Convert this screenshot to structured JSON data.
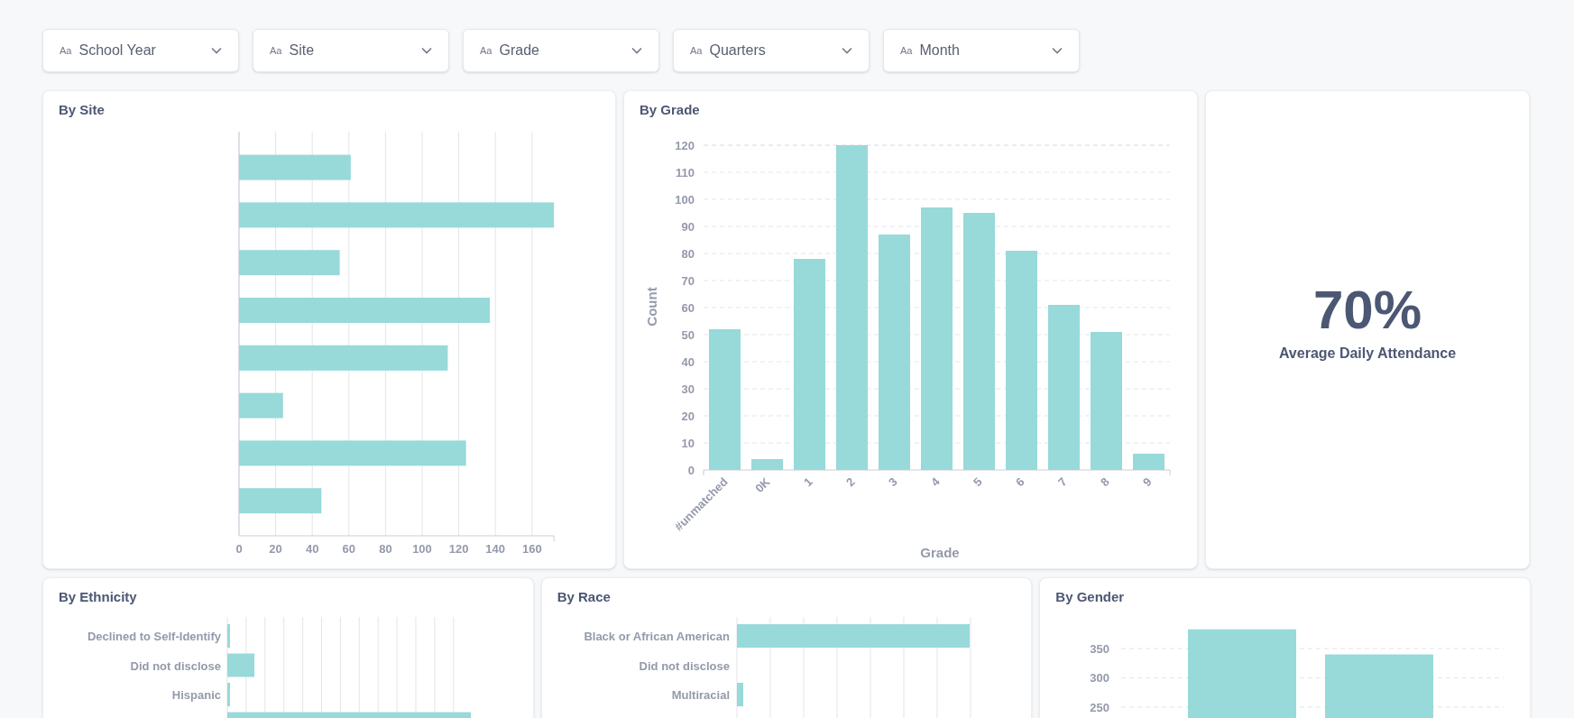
{
  "filters": [
    {
      "icon_text": "Aa",
      "label": "School Year"
    },
    {
      "icon_text": "Aa",
      "label": "Site"
    },
    {
      "icon_text": "Aa",
      "label": "Grade"
    },
    {
      "icon_text": "Aa",
      "label": "Quarters"
    },
    {
      "icon_text": "Aa",
      "label": "Month"
    }
  ],
  "by_site": {
    "title": "By Site",
    "chart_data": {
      "type": "bar",
      "orientation": "horizontal",
      "values": [
        61,
        172,
        55,
        137,
        114,
        24,
        124,
        45
      ],
      "xticks": [
        0,
        20,
        40,
        60,
        80,
        100,
        120,
        140,
        160
      ],
      "xlim": [
        0,
        172
      ],
      "grid": true
    }
  },
  "by_grade": {
    "title": "By Grade",
    "chart_data": {
      "type": "bar",
      "categories": [
        "#unmatched",
        "0K",
        "1",
        "2",
        "3",
        "4",
        "5",
        "6",
        "7",
        "8",
        "9"
      ],
      "values": [
        52,
        4,
        78,
        120,
        87,
        97,
        95,
        81,
        61,
        51,
        6
      ],
      "xlabel": "Grade",
      "ylabel": "Count",
      "yticks": [
        0,
        10,
        20,
        30,
        40,
        50,
        60,
        70,
        80,
        90,
        100,
        110,
        120
      ],
      "ylim": [
        0,
        120
      ],
      "grid": true
    }
  },
  "kpi": {
    "value": "70%",
    "label": "Average Daily Attendance"
  },
  "by_ethnicity": {
    "title": "By Ethnicity",
    "row_labels": [
      "Declined to Self-Identify",
      "Did not disclose",
      "Hispanic"
    ]
  },
  "by_race": {
    "title": "By Race",
    "row_labels": [
      "Black or African American",
      "Did not disclose",
      "Multiracial"
    ]
  },
  "by_gender": {
    "title": "By Gender",
    "chart_data": {
      "type": "bar",
      "values": [
        383,
        340
      ],
      "yticks": [
        250,
        300,
        350
      ],
      "ylim": [
        211,
        383
      ],
      "grid": true
    }
  }
}
